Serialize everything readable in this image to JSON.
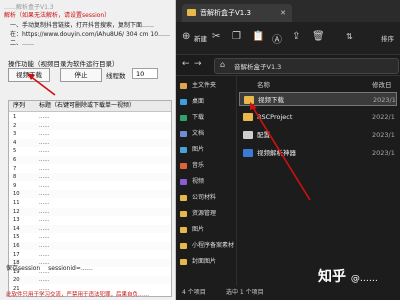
{
  "left_app": {
    "title": "……解析盒子V1.3",
    "instruction_lines": [
      "解析（如果无法解析，请设置session）",
      "一、手动复制抖音链接，打开抖音搜索，复制下面……",
      "在：https://www.douyin.com/iAhu8U6/ 304 cm 10……",
      "二、……"
    ],
    "download_button": "视频下载",
    "stop_button": "停止",
    "thread_label": "线程数",
    "thread_value": "10",
    "section_label": "操作功能（视频目录为软件运行目录）",
    "table": {
      "headers": [
        "序列",
        "标题（右键可删除或下载单一视频）"
      ],
      "rows": [
        {
          "n": "1",
          "title": "……"
        },
        {
          "n": "2",
          "title": "……"
        },
        {
          "n": "3",
          "title": "……"
        },
        {
          "n": "4",
          "title": "……"
        },
        {
          "n": "5",
          "title": "……"
        },
        {
          "n": "6",
          "title": "……"
        },
        {
          "n": "7",
          "title": "……"
        },
        {
          "n": "8",
          "title": "……"
        },
        {
          "n": "9",
          "title": "……"
        },
        {
          "n": "10",
          "title": "……"
        },
        {
          "n": "11",
          "title": "……"
        },
        {
          "n": "12",
          "title": "……"
        },
        {
          "n": "13",
          "title": "……"
        },
        {
          "n": "14",
          "title": "……"
        },
        {
          "n": "15",
          "title": "……"
        },
        {
          "n": "16",
          "title": "……"
        },
        {
          "n": "17",
          "title": "……"
        },
        {
          "n": "18",
          "title": "……"
        },
        {
          "n": "19",
          "title": "……"
        },
        {
          "n": "20",
          "title": "……"
        },
        {
          "n": "21",
          "title": "……"
        }
      ]
    },
    "save_session_label": "保存session",
    "session_value": "sessionid=……",
    "footer_note": "此软件只用于学习交流，严禁用于违法犯罪，后果自负……"
  },
  "explorer": {
    "tab_title": "音解析盒子V1.3",
    "new_label": "新建",
    "sort_label": "排序",
    "breadcrumb": "音解析盒子V1.3",
    "nav_items": [
      {
        "label": "主文件夹",
        "color": "#e0a84a"
      },
      {
        "label": "桌面",
        "color": "#3aa0e0"
      },
      {
        "label": "下载",
        "color": "#2fa36b"
      },
      {
        "label": "文档",
        "color": "#6b8fd6"
      },
      {
        "label": "图片",
        "color": "#4aa0d8"
      },
      {
        "label": "音乐",
        "color": "#e0623a"
      },
      {
        "label": "视频",
        "color": "#8a5cd6"
      },
      {
        "label": "公司材料",
        "color": "#e8b94a"
      },
      {
        "label": "资源管理",
        "color": "#e8b94a"
      },
      {
        "label": "图片",
        "color": "#e8b94a"
      },
      {
        "label": "小程序备案素材",
        "color": "#e8b94a"
      },
      {
        "label": "封面图片",
        "color": "#e8b94a"
      }
    ],
    "columns": {
      "name": "名称",
      "date": "修改日"
    },
    "files": [
      {
        "name": "视频下载",
        "date": "2023/1",
        "color": "#e8b94a",
        "selected": true
      },
      {
        "name": "RSCProject",
        "date": "2022/1",
        "color": "#e8b94a",
        "selected": false
      },
      {
        "name": "配置",
        "date": "2023/1",
        "color": "#cfcfcf",
        "selected": false
      },
      {
        "name": "视频解析神器",
        "date": "2023/1",
        "color": "#3a7bd5",
        "selected": false
      }
    ],
    "status_count": "4 个项目",
    "status_selected": "选中 1 个项目"
  },
  "watermark": {
    "brand": "知乎",
    "handle": "@……"
  },
  "colors": {
    "accent_red": "#cc1010",
    "explorer_bg": "#1c1c1c"
  }
}
